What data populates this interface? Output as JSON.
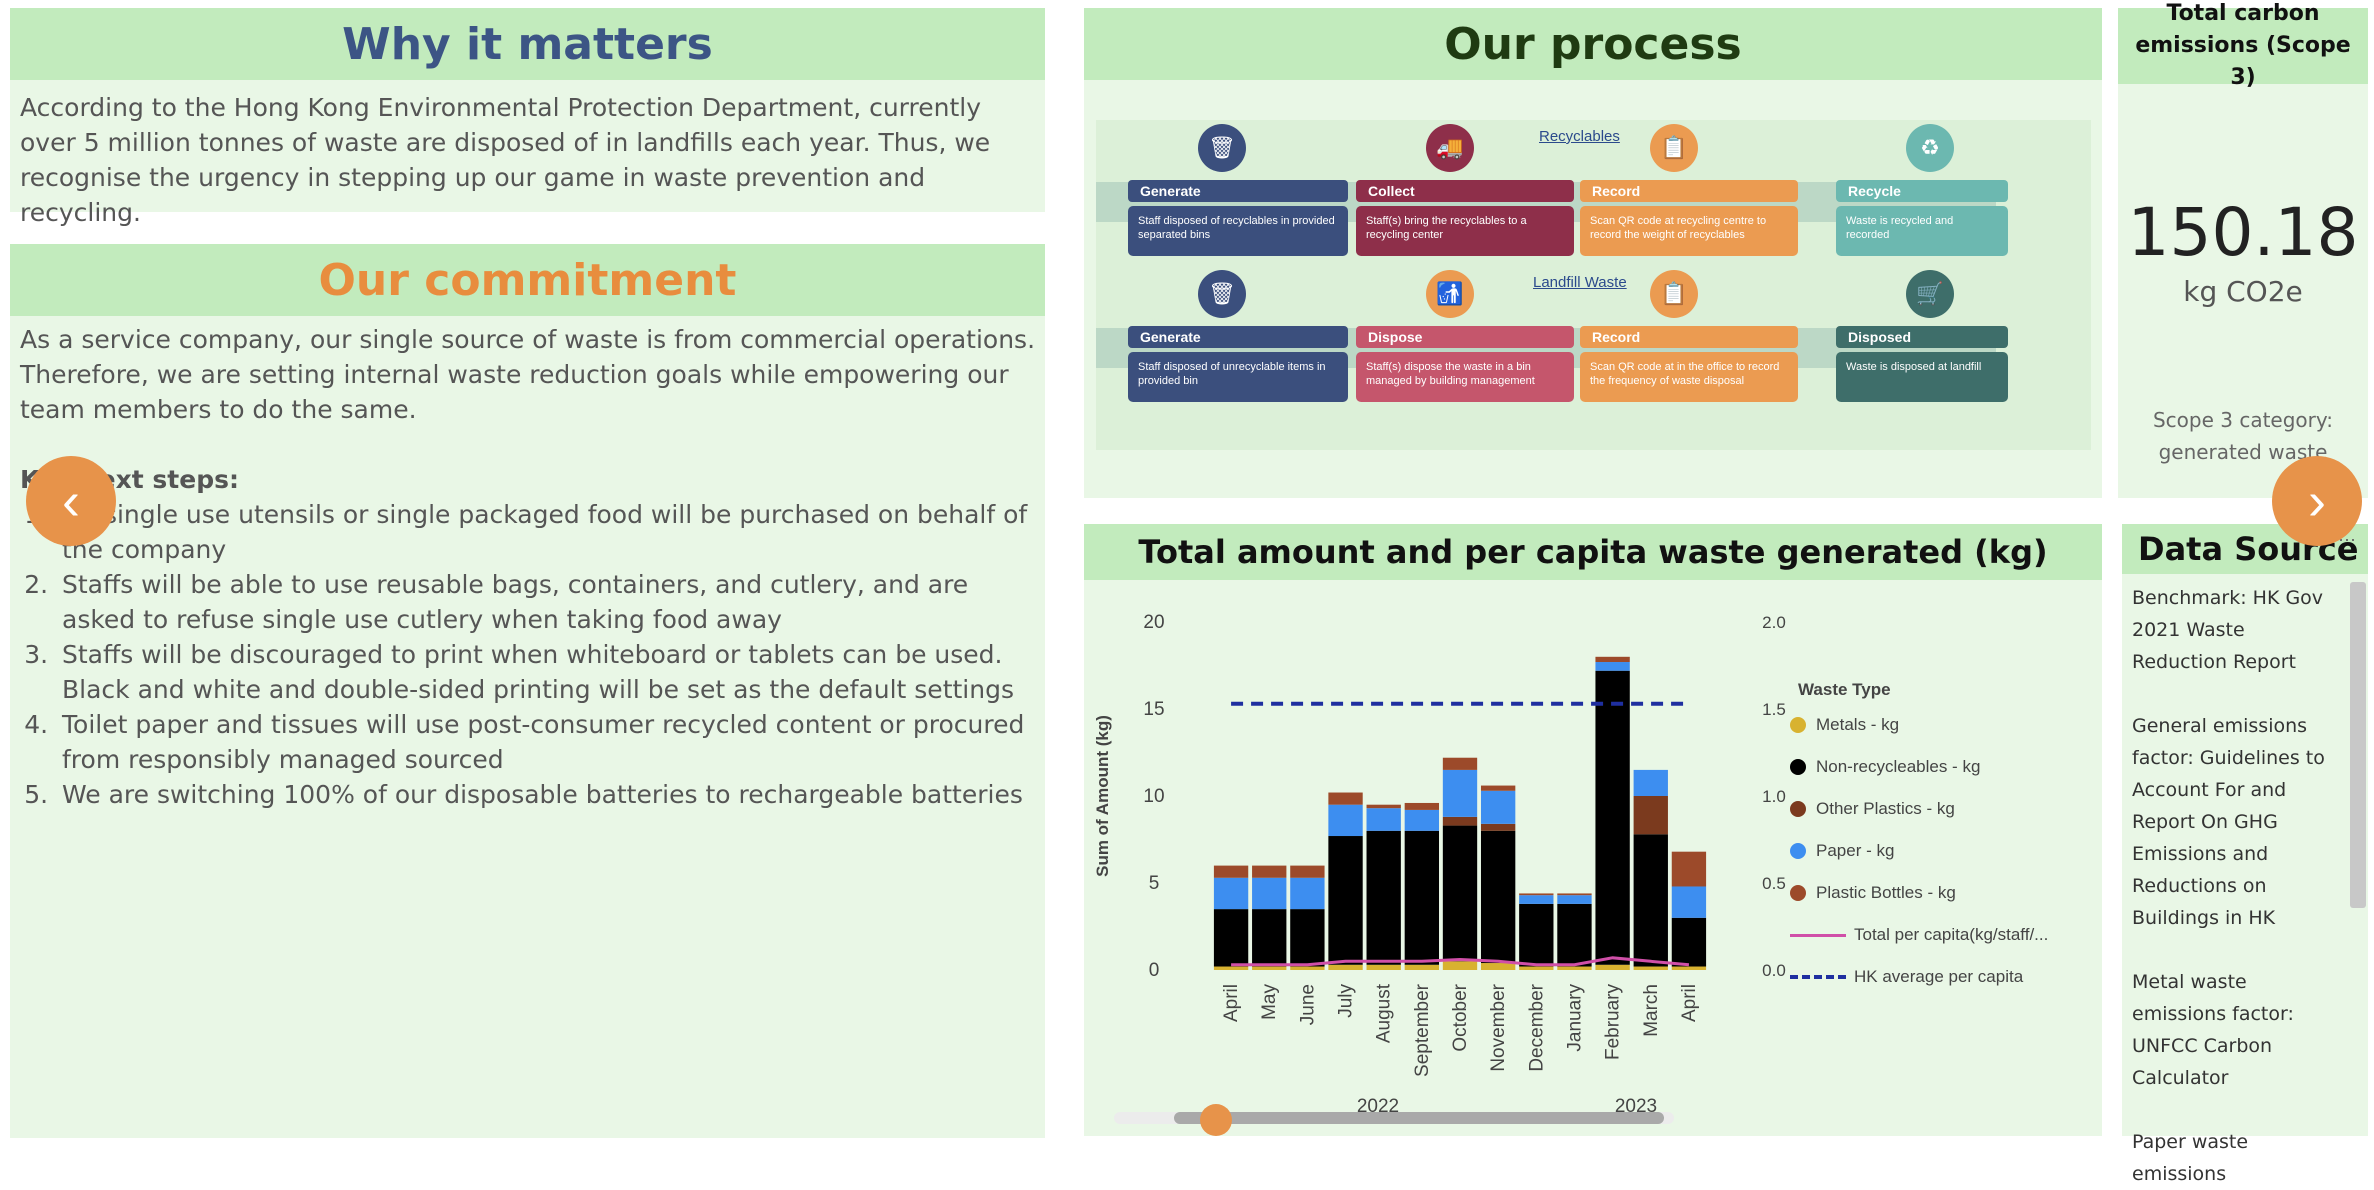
{
  "why": {
    "title": "Why it matters",
    "text": "According to the Hong Kong Environmental Protection Department, currently over 5 million tonnes of waste are disposed of in landfills each year. Thus, we recognise the urgency in stepping up our game in waste prevention and recycling."
  },
  "commitment": {
    "title": "Our commitment",
    "text_1": "As a service company, our single source of waste is from commercial operations. Therefore, we are setting internal waste reduction goals while empowering our team members to do the same.",
    "steps_heading": "Key next steps:",
    "steps": [
      "No single use utensils or single packaged food will be purchased on behalf of the company",
      "Staffs will be able to use reusable bags, containers, and cutlery, and are asked to refuse single use cutlery when taking food away",
      "Staffs will be discouraged to print when whiteboard or tablets can be used. Black and white and double-sided printing will be set as the default settings",
      "Toilet paper and tissues will use post-consumer recycled content or procured from responsibly managed sourced",
      "We are switching 100% of our disposable batteries to rechargeable batteries"
    ]
  },
  "process": {
    "title": "Our process",
    "recyclables_link": "Recyclables",
    "landfill_link": "Landfill Waste",
    "row1": [
      {
        "head": "Generate",
        "body": "Staff disposed of recyclables in provided separated bins",
        "color": "#3b4f7d",
        "icon": "trash-icon"
      },
      {
        "head": "Collect",
        "body": "Staff(s) bring the recyclables to a recycling center",
        "color": "#8e2f4a",
        "icon": "truck-icon"
      },
      {
        "head": "Record",
        "body": "Scan QR code at recycling centre to record the weight of recyclables",
        "color": "#eb9b51",
        "icon": "clipboard-icon"
      },
      {
        "head": "Recycle",
        "body": "Waste is recycled and recorded",
        "color": "#6cb8b0",
        "icon": "recycle-icon"
      }
    ],
    "row2": [
      {
        "head": "Generate",
        "body": "Staff disposed of unrecyclable items in provided bin",
        "color": "#3b4f7d",
        "icon": "trash-icon"
      },
      {
        "head": "Dispose",
        "body": "Staff(s) dispose the waste in a bin managed by building management",
        "color": "#c5566c",
        "icon": "person-bin-icon"
      },
      {
        "head": "Record",
        "body": "Scan QR code at in the office to record the frequency of waste disposal",
        "color": "#eb9b51",
        "icon": "clipboard-icon"
      },
      {
        "head": "Disposed",
        "body": "Waste is disposed at landfill",
        "color": "#3e6e6a",
        "icon": "wheelbarrow-icon"
      }
    ]
  },
  "emissions": {
    "title": "Total carbon emissions (Scope 3)",
    "value": "150.18",
    "unit": "kg CO2e",
    "category_label": "Scope 3 category: generated waste"
  },
  "datasource": {
    "title": "Data Source",
    "text_1": "Benchmark: HK Gov 2021 Waste Reduction Report",
    "text_2": "General emissions factor: Guidelines to Account For and Report On GHG Emissions and Reductions on Buildings in HK",
    "text_3": "Metal waste emissions factor: UNFCC Carbon Calculator",
    "text_4": "Paper waste emissions"
  },
  "chart_data": {
    "type": "bar",
    "title": "Total amount and per capita waste generated (kg)",
    "ylabel": "Sum of Amount (kg)",
    "ylim": [
      0,
      20
    ],
    "y2lim": [
      0,
      2.0
    ],
    "y_ticks": [
      "0",
      "5",
      "10",
      "15",
      "20"
    ],
    "y2_ticks": [
      "0.0",
      "0.5",
      "1.0",
      "1.5",
      "2.0"
    ],
    "categories": [
      "April",
      "May",
      "June",
      "July",
      "August",
      "September",
      "October",
      "November",
      "December",
      "January",
      "February",
      "March",
      "April"
    ],
    "year_labels": [
      "2022",
      "2023"
    ],
    "legend_title": "Waste Type",
    "series": [
      {
        "name": "Metals - kg",
        "color": "#d8b230",
        "values": [
          0.2,
          0.2,
          0.2,
          0.3,
          0.3,
          0.3,
          0.5,
          0.4,
          0.2,
          0.2,
          0.3,
          0.2,
          0.2
        ]
      },
      {
        "name": "Non-recycleables - kg",
        "color": "#000000",
        "values": [
          3.3,
          3.3,
          3.3,
          7.4,
          7.7,
          7.7,
          7.8,
          7.6,
          3.6,
          3.6,
          16.9,
          7.6,
          2.8
        ]
      },
      {
        "name": "Other Plastics - kg",
        "color": "#7b3a1e",
        "values": [
          0,
          0,
          0,
          0,
          0,
          0,
          0.5,
          0.4,
          0,
          0,
          0,
          2.2,
          0
        ]
      },
      {
        "name": "Paper - kg",
        "color": "#3d8ef0",
        "values": [
          1.8,
          1.8,
          1.8,
          1.8,
          1.3,
          1.2,
          2.7,
          1.9,
          0.5,
          0.5,
          0.5,
          1.5,
          1.8
        ]
      },
      {
        "name": "Plastic Bottles - kg",
        "color": "#9c4a2a",
        "values": [
          0.7,
          0.7,
          0.7,
          0.7,
          0.2,
          0.4,
          0.7,
          0.3,
          0.1,
          0.1,
          0.3,
          0,
          2.0
        ]
      }
    ],
    "lines": [
      {
        "name": "Total per capita(kg/staff/...",
        "color": "#d04fa8",
        "style": "solid",
        "axis": "y2",
        "values": [
          0.03,
          0.03,
          0.03,
          0.05,
          0.05,
          0.05,
          0.06,
          0.05,
          0.03,
          0.03,
          0.07,
          0.05,
          0.03
        ]
      },
      {
        "name": "HK average per capita",
        "color": "#1f2fa0",
        "style": "dashed",
        "axis": "y2",
        "values": [
          1.53,
          1.53,
          1.53,
          1.53,
          1.53,
          1.53,
          1.53,
          1.53,
          1.53,
          1.53,
          1.53,
          1.53,
          1.53
        ]
      }
    ],
    "legend_position": "right"
  },
  "colors": {
    "header_bg": "#c2ebbd",
    "panel_bg": "#e9f7e6",
    "title_blue": "#3c5585",
    "title_orange": "#e88d3e",
    "nav_button": "#e7934a"
  }
}
